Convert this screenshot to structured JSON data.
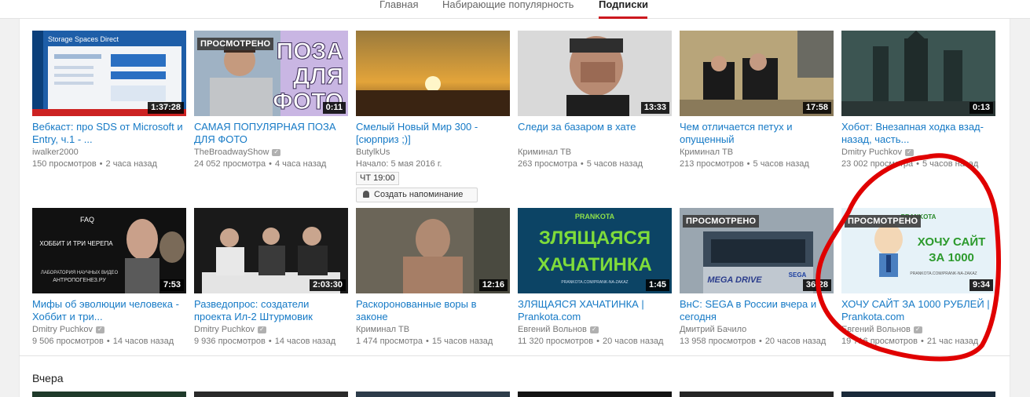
{
  "nav": {
    "tabs": [
      "Главная",
      "Набирающие популярность",
      "Подписки"
    ],
    "active_tab": "Подписки"
  },
  "sections": {
    "yesterday": "Вчера"
  },
  "badges": {
    "watched": "ПРОСМОТРЕНО"
  },
  "row1": [
    {
      "title": "Вебкаст: про SDS от Microsoft и Entry, ч.1 - ...",
      "channel": "iwalker2000",
      "verified": false,
      "views": "150 просмотров",
      "age": "2 часа назад",
      "duration": "1:37:28",
      "watched": false
    },
    {
      "title": "САМАЯ ПОПУЛЯРНАЯ ПОЗА ДЛЯ ФОТО",
      "channel": "TheBroadwayShow",
      "verified": true,
      "views": "24 052 просмотра",
      "age": "4 часа назад",
      "duration": "0:11",
      "watched": true
    },
    {
      "title": "Смелый Новый Мир 300 - [сюрприз ;)]",
      "channel": "ButylkUs",
      "verified": false,
      "start": "Начало: 5 мая 2016 г.",
      "time_badge": "ЧТ 19:00",
      "reminder": "Создать напоминание"
    },
    {
      "title": "Следи за базаром в хате",
      "channel": "Криминал ТВ",
      "verified": false,
      "views": "263 просмотра",
      "age": "5 часов назад",
      "duration": "13:33",
      "watched": false
    },
    {
      "title": "Чем отличается петух и опущенный",
      "channel": "Криминал ТВ",
      "verified": false,
      "views": "213 просмотров",
      "age": "5 часов назад",
      "duration": "17:58",
      "watched": false
    },
    {
      "title": "Хобот: Внезапная ходка взад-назад, часть...",
      "channel": "Dmitry Puchkov",
      "verified": true,
      "views": "23 002 просмотра",
      "age": "5 часов назад",
      "duration": "0:13",
      "watched": false
    }
  ],
  "row2": [
    {
      "title": "Мифы об эволюции человека - Хоббит и три...",
      "channel": "Dmitry Puchkov",
      "verified": true,
      "views": "9 506 просмотров",
      "age": "14 часов назад",
      "duration": "7:53",
      "watched": false
    },
    {
      "title": "Разведопрос: создатели проекта Ил-2 Штурмовик",
      "channel": "Dmitry Puchkov",
      "verified": true,
      "views": "9 936 просмотров",
      "age": "14 часов назад",
      "duration": "2:03:30",
      "watched": false
    },
    {
      "title": "Раскоронованные воры в законе",
      "channel": "Криминал ТВ",
      "verified": false,
      "views": "1 474 просмотра",
      "age": "15 часов назад",
      "duration": "12:16",
      "watched": false
    },
    {
      "title": "ЗЛЯЩАЯСЯ ХАЧАТИНКА | Prankota.com",
      "channel": "Евгений Вольнов",
      "verified": true,
      "views": "11 320 просмотров",
      "age": "20 часов назад",
      "duration": "1:45",
      "watched": false
    },
    {
      "title": "ВнС: SEGA в России вчера и сегодня",
      "channel": "Дмитрий Бачило",
      "verified": false,
      "views": "13 958 просмотров",
      "age": "20 часов назад",
      "duration": "36:28",
      "watched": true
    },
    {
      "title": "ХОЧУ САЙТ ЗА 1000 РУБЛЕЙ | Prankota.com",
      "channel": "Евгений Вольнов",
      "verified": true,
      "views": "19 716 просмотров",
      "age": "21 час назад",
      "duration": "9:34",
      "watched": true
    }
  ],
  "thumb_text": {
    "t1": "Storage Spaces Direct",
    "t2": [
      "ПОЗА",
      "ДЛЯ",
      "ФОТО"
    ],
    "t7": [
      "FAQ",
      "ХОББИТ И ТРИ ЧЕРЕПА",
      "ЛАБОРАТОРИЯ НАУЧНЫХ ВИДЕО",
      "АНТРОПОГЕНЕЗ.РУ"
    ],
    "t10": [
      "PRANKOTA",
      "ЗЛЯЩАЯСЯ",
      "ХАЧАТИНКА",
      "PRANKOTA.COM/PRANK-NA-ZAKAZ"
    ],
    "t11": [
      "MEGA DRIVE",
      "SEGA"
    ],
    "t12": [
      "PRANKOTA",
      "ХОЧУ САЙТ",
      "ЗА 1000",
      "PRANKOTA.COM/PRANK-NA-ZAKAZ"
    ]
  },
  "colors": {
    "link": "#167ac6",
    "accent": "#cc181e",
    "annotation": "#e00000"
  }
}
